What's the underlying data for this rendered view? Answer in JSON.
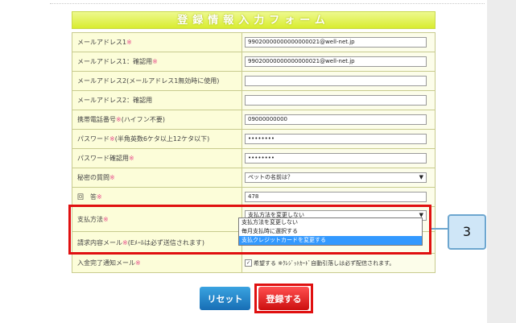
{
  "form_title": "登録情報入力フォーム",
  "rows": [
    {
      "label": "メールアドレス1",
      "req": "※",
      "value": "99020000000000000021@well-net.jp"
    },
    {
      "label": "メールアドレス1：確認用",
      "req": "※",
      "value": "99020000000000000021@well-net.jp"
    },
    {
      "label": "メールアドレス2(メールアドレス1無効時に使用)",
      "req": "",
      "value": ""
    },
    {
      "label": "メールアドレス2：確認用",
      "req": "",
      "value": ""
    },
    {
      "label": "携帯電話番号",
      "req": "※",
      "label_suffix": "(ハイフン不要)",
      "value": "09000000000"
    },
    {
      "label": "パスワード",
      "req": "※",
      "label_suffix": "(半角英数6ケタ以上12ケタ以下)",
      "value": "••••••••"
    },
    {
      "label": "パスワード確認用",
      "req": "※",
      "value": "••••••••"
    }
  ],
  "secret_question": {
    "label": "秘密の質問",
    "req": "※",
    "value": "ペットの名前は？"
  },
  "answer": {
    "label": "回　答",
    "req": "※",
    "value": "478"
  },
  "payment": {
    "label": "支払方法",
    "req": "※",
    "value": "支払方法を変更しない",
    "options": [
      "支払方法を変更しない",
      "毎月支払時に選択する",
      "支払クレジットカードを変更する"
    ],
    "highlighted_index": 2
  },
  "billing_mail": {
    "label": "請求内容メール",
    "req": "※",
    "label_suffix": "(Eﾒｰﾙは必ず送信されます)"
  },
  "payment_notice": {
    "label": "入金完了通知メール",
    "req": "※",
    "check_mark": "✓",
    "check_text": "希望する",
    "note": "※ｸﾚｼﾞｯﾄｶｰﾄﾞ自動引落しは必ず配信されます。"
  },
  "callout_number": "3",
  "buttons": {
    "reset": "リセット",
    "register": "登録する"
  },
  "select_arrow": "▼",
  "colors": {
    "highlight": "#3399ff",
    "annotation_red": "#e01010",
    "callout_blue": "#cfe6f7"
  }
}
